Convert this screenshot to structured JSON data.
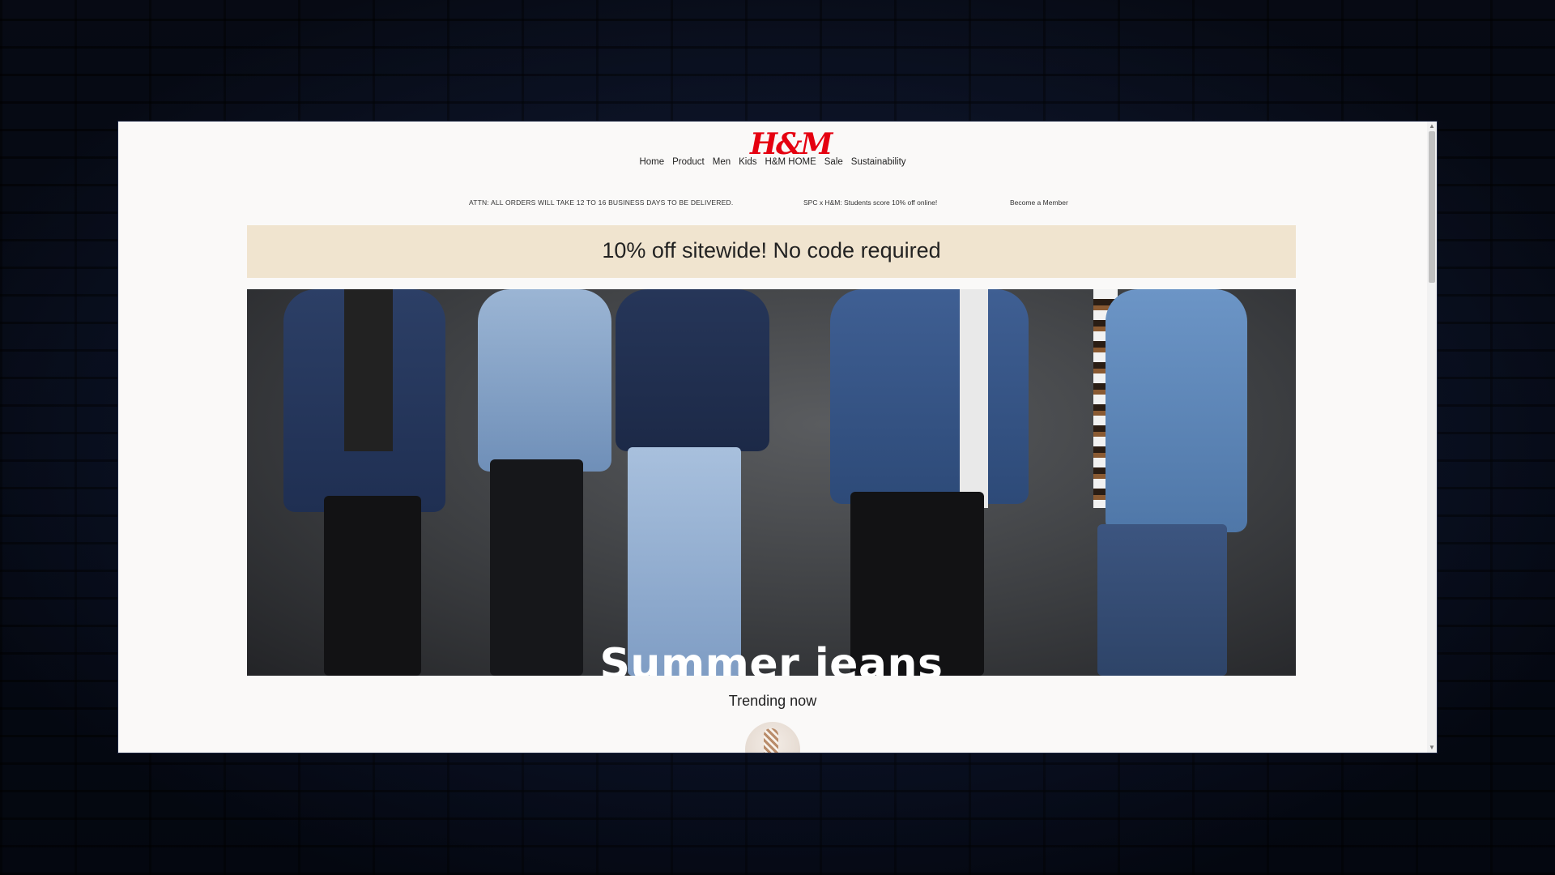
{
  "brand": {
    "logo_text": "H&M",
    "logo_color": "#e50010"
  },
  "nav": {
    "items": [
      "Home",
      "Product",
      "Men",
      "Kids",
      "H&M HOME",
      "Sale",
      "Sustainability"
    ]
  },
  "notices": [
    "ATTN: ALL ORDERS WILL TAKE 12 TO 16 BUSINESS DAYS TO BE DELIVERED.",
    "SPC x H&M: Students score 10% off online!",
    "Become a Member"
  ],
  "promo": {
    "text": "10% off sitewide! No code required",
    "background": "#f0e4cf"
  },
  "hero": {
    "title": "Summer jeans"
  },
  "trending": {
    "heading": "Trending now"
  }
}
